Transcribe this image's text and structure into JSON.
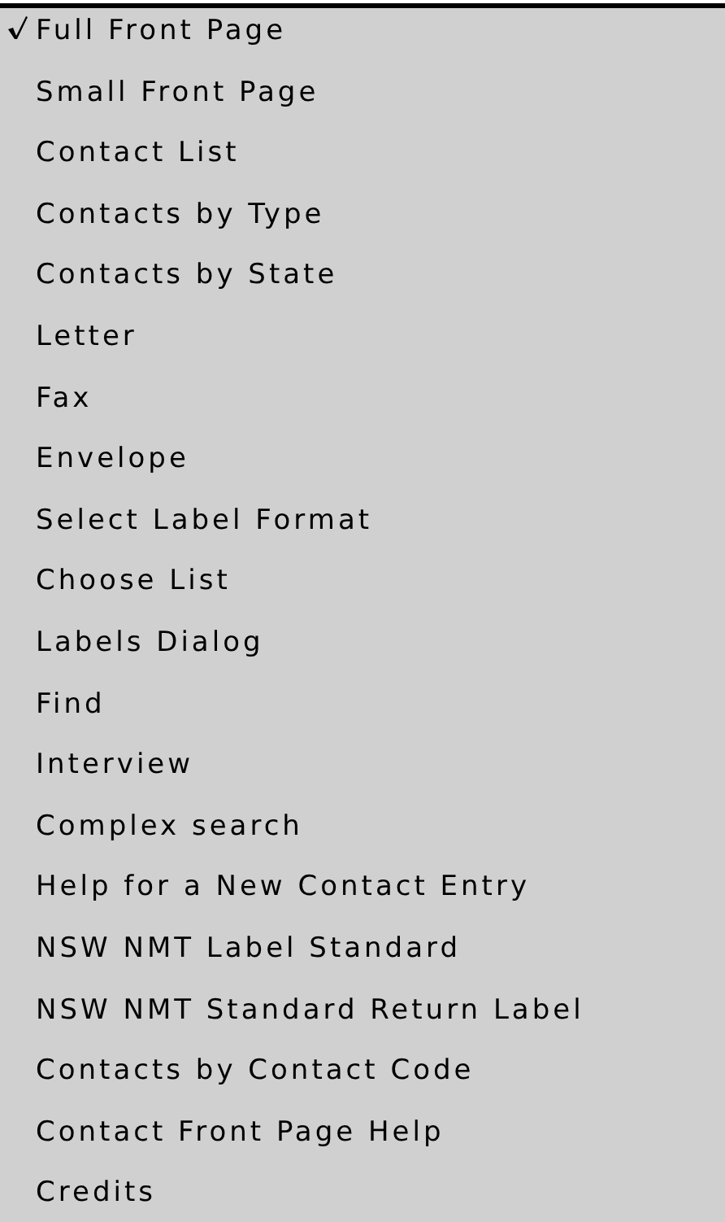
{
  "menu": {
    "items": [
      {
        "label": "Full Front Page",
        "checked": true
      },
      {
        "label": "Small Front Page",
        "checked": false
      },
      {
        "label": "Contact List",
        "checked": false
      },
      {
        "label": "Contacts by Type",
        "checked": false
      },
      {
        "label": "Contacts by State",
        "checked": false
      },
      {
        "label": "Letter",
        "checked": false
      },
      {
        "label": "Fax",
        "checked": false
      },
      {
        "label": "Envelope",
        "checked": false
      },
      {
        "label": "Select Label Format",
        "checked": false
      },
      {
        "label": "Choose List",
        "checked": false
      },
      {
        "label": "Labels Dialog",
        "checked": false
      },
      {
        "label": "Find",
        "checked": false
      },
      {
        "label": "Interview",
        "checked": false
      },
      {
        "label": "Complex search",
        "checked": false
      },
      {
        "label": "Help for a New Contact Entry",
        "checked": false
      },
      {
        "label": "NSW NMT Label Standard",
        "checked": false
      },
      {
        "label": "NSW NMT Standard Return Label",
        "checked": false
      },
      {
        "label": "Contacts by Contact Code",
        "checked": false
      },
      {
        "label": "Contact Front Page Help",
        "checked": false
      },
      {
        "label": "Credits",
        "checked": false
      }
    ]
  }
}
